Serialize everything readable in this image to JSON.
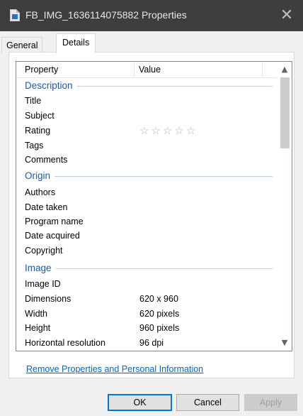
{
  "window": {
    "title": "FB_IMG_1636114075882 Properties",
    "close_glyph": "✕"
  },
  "tabs": [
    {
      "label": "General",
      "selected": false
    },
    {
      "label": "Details",
      "selected": true
    }
  ],
  "list": {
    "headers": {
      "property": "Property",
      "value": "Value"
    },
    "groups": {
      "description": {
        "name": "Description",
        "rows": [
          {
            "property": "Title",
            "value": ""
          },
          {
            "property": "Subject",
            "value": ""
          },
          {
            "property": "Rating",
            "value": ""
          },
          {
            "property": "Tags",
            "value": ""
          },
          {
            "property": "Comments",
            "value": ""
          }
        ]
      },
      "origin": {
        "name": "Origin",
        "rows": [
          {
            "property": "Authors",
            "value": ""
          },
          {
            "property": "Date taken",
            "value": ""
          },
          {
            "property": "Program name",
            "value": ""
          },
          {
            "property": "Date acquired",
            "value": ""
          },
          {
            "property": "Copyright",
            "value": ""
          }
        ]
      },
      "image": {
        "name": "Image",
        "rows": [
          {
            "property": "Image ID",
            "value": ""
          },
          {
            "property": "Dimensions",
            "value": "620 x 960"
          },
          {
            "property": "Width",
            "value": "620 pixels"
          },
          {
            "property": "Height",
            "value": "960 pixels"
          },
          {
            "property": "Horizontal resolution",
            "value": "96 dpi"
          }
        ]
      }
    },
    "rating_stars": 0,
    "rating_max": 5
  },
  "link": {
    "remove_properties": "Remove Properties and Personal Information"
  },
  "buttons": {
    "ok": "OK",
    "cancel": "Cancel",
    "apply": "Apply",
    "apply_enabled": false
  },
  "colors": {
    "titlebar": "#3d3e3f",
    "group_heading": "#1e5aa8",
    "link": "#0066cc",
    "default_button_border": "#0078d7"
  }
}
